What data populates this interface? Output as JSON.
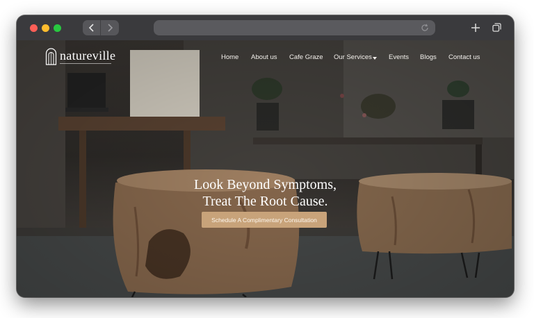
{
  "browser": {
    "url": "",
    "controls": {
      "close": "close-button",
      "minimize": "minimize-button",
      "maximize": "maximize-button"
    },
    "icons": [
      "chevron-left-icon",
      "chevron-right-icon",
      "reload-icon",
      "plus-icon",
      "tabs-icon"
    ]
  },
  "site": {
    "brand": "natureville",
    "nav": [
      {
        "label": "Home"
      },
      {
        "label": "About us"
      },
      {
        "label": "Cafe Graze"
      },
      {
        "label": "Our Services"
      },
      {
        "label": "Events"
      },
      {
        "label": "Blogs"
      },
      {
        "label": "Contact us"
      }
    ],
    "hero": {
      "line1": "Look Beyond Symptoms,",
      "line2": "Treat The Root Cause.",
      "cta": "Schedule A Complimentary Consultation"
    },
    "colors": {
      "accent": "#c8a37a",
      "text": "#ffffff"
    }
  }
}
